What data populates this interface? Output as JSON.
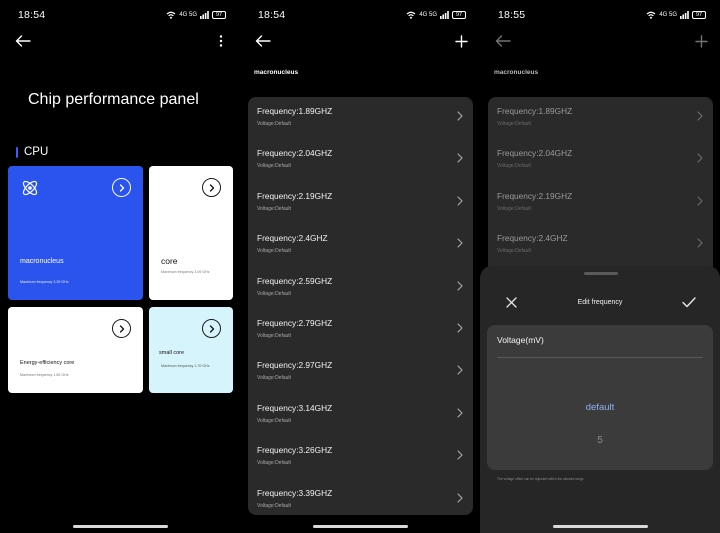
{
  "status_bar": {
    "time_1": "18:54",
    "time_2": "18:54",
    "time_3": "18:55",
    "network": "4G 5G",
    "battery": "97"
  },
  "screen1": {
    "title": "Chip performance panel",
    "section": "CPU",
    "cards": [
      {
        "name": "macronucleus",
        "sub": "Maximum frequency 3.39 GHz",
        "color": "#2b54ef"
      },
      {
        "name": "core",
        "sub": "Maximum frequency 3.09 GHz",
        "color": "#ffffff"
      },
      {
        "name": "Energy-efficiency core",
        "sub": "Maximum frequency 1.89 GHz",
        "color": "#ffffff"
      },
      {
        "name": "small core",
        "sub": "Maximum frequency 1.70 GHz",
        "color": "#d6f4fb"
      }
    ]
  },
  "screen2": {
    "subtitle": "macronucleus",
    "rows": [
      {
        "freq": "Frequency:1.89GHZ",
        "volt": "Voltage:Default"
      },
      {
        "freq": "Frequency:2.04GHZ",
        "volt": "Voltage:Default"
      },
      {
        "freq": "Frequency:2.19GHZ",
        "volt": "Voltage:Default"
      },
      {
        "freq": "Frequency:2.4GHZ",
        "volt": "Voltage:Default"
      },
      {
        "freq": "Frequency:2.59GHZ",
        "volt": "Voltage:Default"
      },
      {
        "freq": "Frequency:2.79GHZ",
        "volt": "Voltage:Default"
      },
      {
        "freq": "Frequency:2.97GHZ",
        "volt": "Voltage:Default"
      },
      {
        "freq": "Frequency:3.14GHZ",
        "volt": "Voltage:Default"
      },
      {
        "freq": "Frequency:3.26GHZ",
        "volt": "Voltage:Default"
      },
      {
        "freq": "Frequency:3.39GHZ",
        "volt": "Voltage:Default"
      }
    ]
  },
  "screen3": {
    "subtitle": "macronucleus",
    "rows": [
      {
        "freq": "Frequency:1.89GHZ",
        "volt": "Voltage:Default"
      },
      {
        "freq": "Frequency:2.04GHZ",
        "volt": "Voltage:Default"
      },
      {
        "freq": "Frequency:2.19GHZ",
        "volt": "Voltage:Default"
      },
      {
        "freq": "Frequency:2.4GHZ",
        "volt": "Voltage:Default"
      }
    ],
    "sheet": {
      "title": "Edit frequency",
      "field_label": "Voltage(mV)",
      "selected_option": "default",
      "next_option": "5",
      "hint": "The voltage offset can be adjusted within the allowed range"
    }
  },
  "icons": {
    "back": "arrow-left-icon",
    "more": "more-vertical-icon",
    "add": "plus-icon",
    "chevron": "chevron-right-icon",
    "cpu": "atom-icon",
    "close": "close-icon",
    "confirm": "check-icon"
  },
  "colors": {
    "accent": "#2b54ef",
    "section_marker": "#3a5cff",
    "selected_option": "#8fb0f2"
  }
}
